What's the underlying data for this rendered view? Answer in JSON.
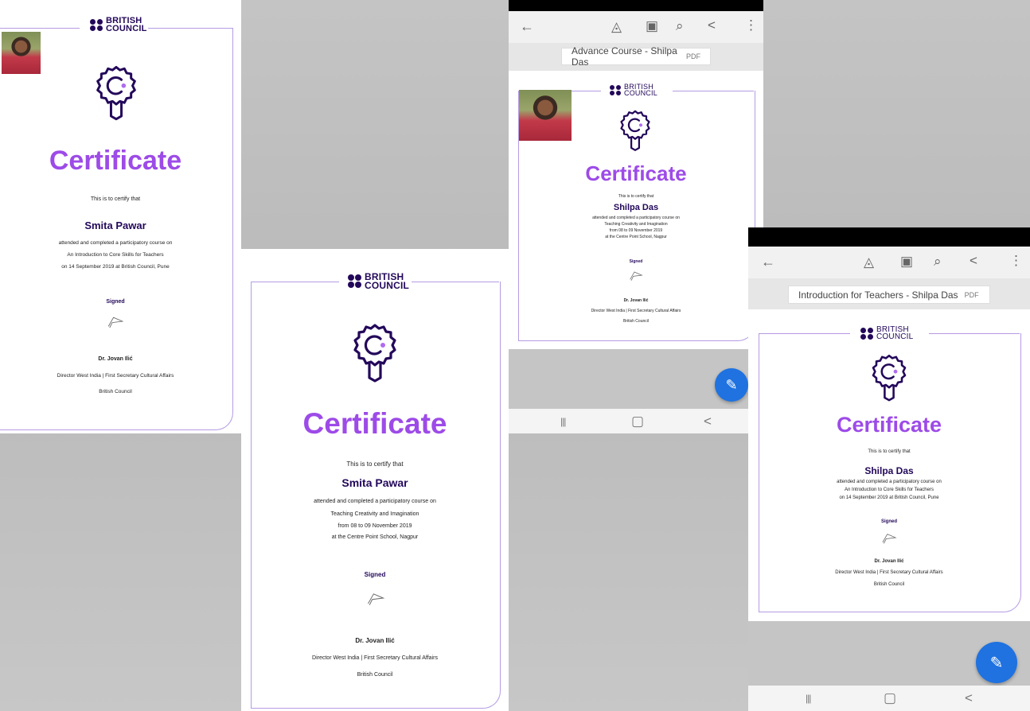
{
  "colors": {
    "brand": "#23085a",
    "accent": "#9d4be8",
    "frame": "#b59be3",
    "fab": "#1f72e0"
  },
  "cert1": {
    "logo": [
      "BRITISH",
      "COUNCIL"
    ],
    "title": "Certificate",
    "certify": "This is to certify that",
    "name": "Smita Pawar",
    "line1": "attended and completed a participatory course on",
    "line2": "An Introduction to Core Skills for Teachers",
    "line3": "on 14 September 2019 at British Council, Pune",
    "signed": "Signed",
    "signer": "Dr. Jovan Ilić",
    "role": "Director West India | First Secretary Cultural Affairs",
    "org": "British Council"
  },
  "cert2": {
    "logo": [
      "BRITISH",
      "COUNCIL"
    ],
    "title": "Certificate",
    "certify": "This is to certify that",
    "name": "Smita Pawar",
    "line1": "attended and completed a participatory course on",
    "line2": "Teaching Creativity and Imagination",
    "line3": "from 08 to 09 November 2019",
    "line4": "at the Centre Point School, Nagpur",
    "signed": "Signed",
    "signer": "Dr. Jovan Ilić",
    "role": "Director West India | First Secretary Cultural Affairs",
    "org": "British Council"
  },
  "phone1": {
    "toolbar": {
      "back_icon": "back-arrow-icon",
      "tool_icons": [
        "ink-icon",
        "layout-icon",
        "search-icon",
        "share-icon",
        "more-icon"
      ]
    },
    "doc_title": "Advance Course - Shilpa Das",
    "doc_type": "PDF",
    "cert": {
      "logo": [
        "BRITISH",
        "COUNCIL"
      ],
      "title": "Certificate",
      "certify": "This is to certify that",
      "name": "Shilpa Das",
      "line1": "attended and completed a participatory course on",
      "line2": "Teaching Creativity and Imagination",
      "line3": "from 08 to 09 November 2019",
      "line4": "at the Centre Point School, Nagpur",
      "signed": "Signed",
      "signer": "Dr. Jovan Ilić",
      "role": "Director West India | First Secretary Cultural Affairs",
      "org": "British Council"
    },
    "nav": [
      "|||",
      "▢",
      "<"
    ]
  },
  "phone2": {
    "doc_title": "Introduction for Teachers - Shilpa Das",
    "doc_type": "PDF",
    "cert": {
      "logo": [
        "BRITISH",
        "COUNCIL"
      ],
      "title": "Certificate",
      "certify": "This is to certify that",
      "name": "Shilpa Das",
      "line1": "attended and completed a participatory course on",
      "line2": "An Introduction to Core Skills for Teachers",
      "line3": "on 14 September 2019 at British Council, Pune",
      "signed": "Signed",
      "signer": "Dr. Jovan Ilić",
      "role": "Director West India | First Secretary Cultural Affairs",
      "org": "British Council"
    },
    "nav": [
      "|||",
      "▢",
      "<"
    ]
  }
}
